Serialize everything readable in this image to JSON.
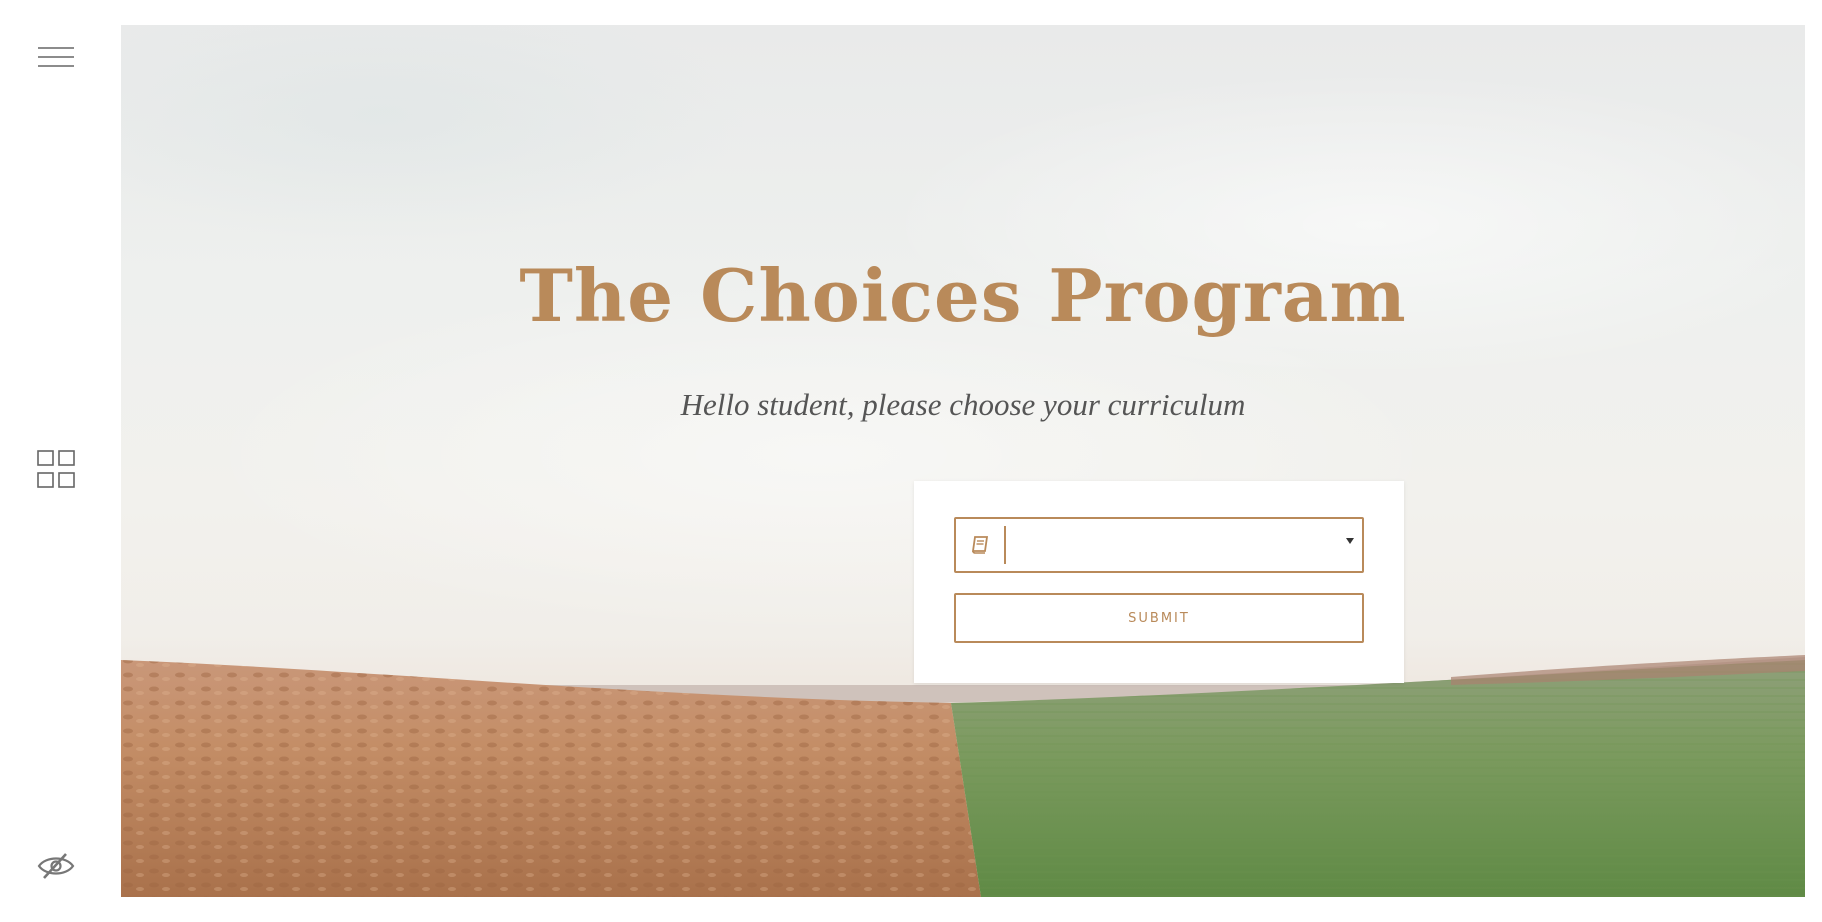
{
  "sidebar": {
    "menu_icon": "hamburger-menu-icon",
    "apps_icon": "grid-icon",
    "visibility_icon": "eye-slash-icon"
  },
  "hero": {
    "title": "The Choices Program",
    "subtitle": "Hello student, please choose your curriculum",
    "background": "sky-and-field-photo"
  },
  "form": {
    "curriculum_select": {
      "icon": "book-icon",
      "value": ""
    },
    "submit_label": "SUBMIT"
  },
  "colors": {
    "accent": "#b98a5a",
    "subtitle_text": "#555555",
    "icon_gray": "#666666"
  }
}
